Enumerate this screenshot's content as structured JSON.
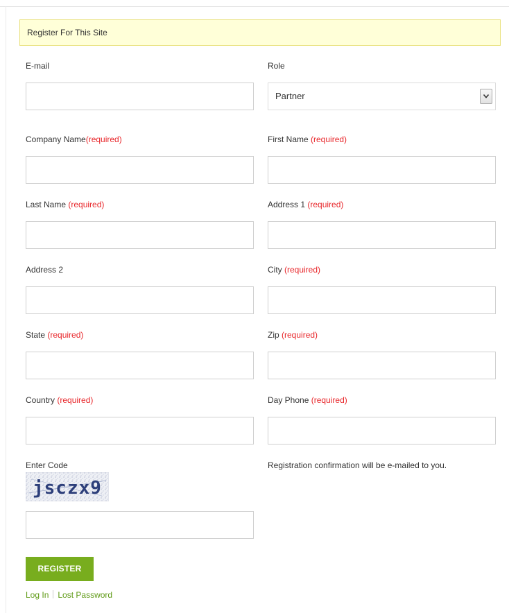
{
  "notice": {
    "text": "Register For This Site"
  },
  "form": {
    "email": {
      "label": "E-mail",
      "required": ""
    },
    "role": {
      "label": "Role",
      "selected": "Partner"
    },
    "company_name": {
      "label": "Company Name",
      "required": "(required)"
    },
    "first_name": {
      "label": "First Name ",
      "required": "(required)"
    },
    "last_name": {
      "label": "Last Name ",
      "required": "(required)"
    },
    "address1": {
      "label": "Address 1 ",
      "required": "(required)"
    },
    "address2": {
      "label": "Address 2",
      "required": ""
    },
    "city": {
      "label": "City ",
      "required": "(required)"
    },
    "state": {
      "label": "State ",
      "required": "(required)"
    },
    "zip": {
      "label": "Zip ",
      "required": "(required)"
    },
    "country": {
      "label": "Country ",
      "required": "(required)"
    },
    "day_phone": {
      "label": "Day Phone ",
      "required": "(required)"
    }
  },
  "captcha": {
    "label": "Enter Code",
    "code": "jsczx9"
  },
  "note": "Registration confirmation will be e-mailed to you.",
  "actions": {
    "register_label": "REGISTER",
    "login_label": "Log In",
    "lost_password_label": "Lost Password"
  },
  "colors": {
    "accent_green": "#78ad1e",
    "required_red": "#e8262a",
    "notice_bg": "#ffffd8"
  }
}
